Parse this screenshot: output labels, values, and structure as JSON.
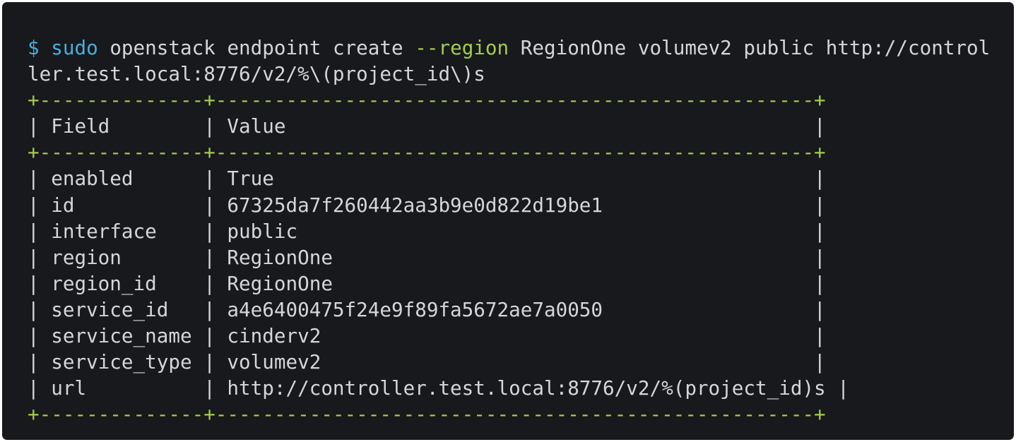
{
  "command": {
    "prompt": "$",
    "sudo": "sudo",
    "part1": " openstack endpoint create ",
    "flag": "--region",
    "part2": " RegionOne volumev2 public http://control",
    "wrap": "ler.test.local:8776/v2/%\\(project_id\\)s"
  },
  "table": {
    "border": "+--------------+---------------------------------------------------+",
    "header": "| Field        | Value                                             |",
    "rows": [
      "| enabled      | True                                              |",
      "| id           | 67325da7f260442aa3b9e0d822d19be1                  |",
      "| interface    | public                                            |",
      "| region       | RegionOne                                         |",
      "| region_id    | RegionOne                                         |",
      "| service_id   | a4e6400475f24e9f89fa5672ae7a0050                  |",
      "| service_name | cinderv2                                          |",
      "| service_type | volumev2                                          |",
      "| url          | http://controller.test.local:8776/v2/%(project_id)s |"
    ]
  },
  "colors": {
    "background": "#17191c",
    "text": "#d4d7da",
    "prompt": "#4aaede",
    "accent_green": "#a3cd4b"
  }
}
